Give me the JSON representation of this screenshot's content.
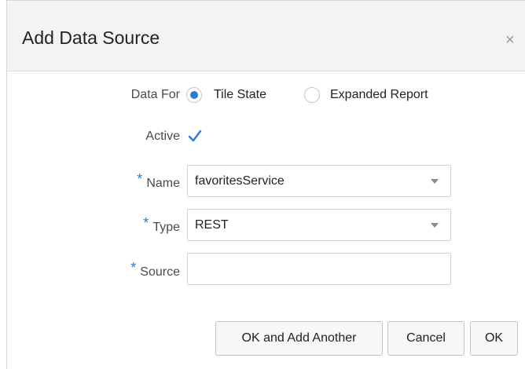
{
  "dialog": {
    "title": "Add Data Source",
    "close_glyph": "×"
  },
  "data_for": {
    "label": "Data For",
    "options": [
      {
        "label": "Tile State",
        "selected": true
      },
      {
        "label": "Expanded Report",
        "selected": false
      }
    ]
  },
  "active": {
    "label": "Active",
    "checked": true
  },
  "name": {
    "required_mark": "*",
    "label": "Name",
    "value": "favoritesService"
  },
  "type": {
    "required_mark": "*",
    "label": "Type",
    "value": "REST"
  },
  "source": {
    "required_mark": "*",
    "label": "Source",
    "value": ""
  },
  "buttons": {
    "ok_add_another": "OK and Add Another",
    "cancel": "Cancel",
    "ok": "OK"
  },
  "colors": {
    "accent": "#2d7bd2",
    "header_bg": "#f3f3f3"
  }
}
